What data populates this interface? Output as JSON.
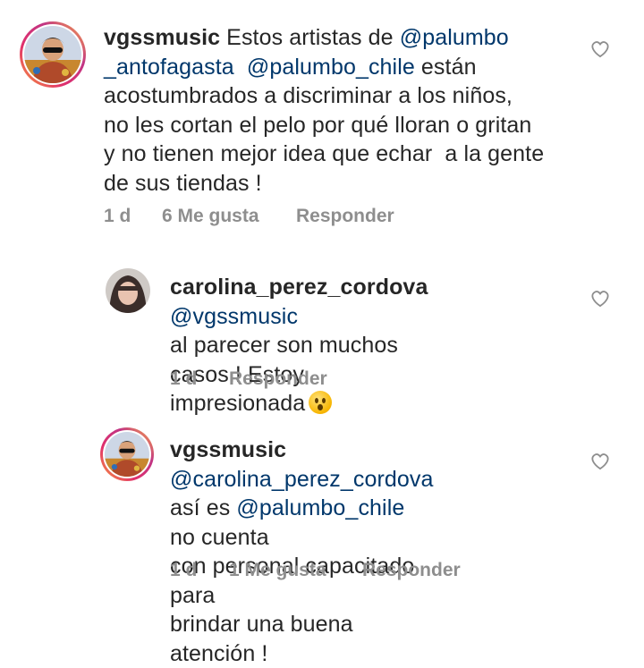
{
  "comments": [
    {
      "username": "vgssmusic",
      "text_parts": [
        {
          "t": "Estos artistas de "
        },
        {
          "t": "@palumbo _antofagasta",
          "mention": true
        },
        {
          "t": " "
        },
        {
          "t": "@palumbo_chile",
          "mention": true
        },
        {
          "t": " están acostumbrados a discriminar a los niños, no les cortan el pelo por qué lloran o gritan y no tienen mejor idea que echar  a la gente de sus tiendas !"
        }
      ],
      "lines": [
        "vgssmusic Estos artistas de @palumbo",
        "_antofagasta  @palumbo_chile están",
        "acostumbrados a discriminar a los niños,",
        "no les cortan el pelo por qué lloran o gritan",
        "y no tienen mejor idea que echar  a la gente",
        "de sus tiendas !"
      ],
      "time": "1 d",
      "likes": "6 Me gusta",
      "reply": "Responder"
    },
    {
      "username": "carolina_perez_cordova",
      "time": "1 d",
      "likes": "",
      "reply": "Responder"
    },
    {
      "username": "vgssmusic",
      "time": "1 d",
      "likes": "1 Me gusta",
      "reply": "Responder"
    }
  ],
  "c1": {
    "l1_user": "vgssmusic",
    "l1_a": " Estos artistas de ",
    "l1_m": "@palumbo",
    "l2_m1": "_antofagasta",
    "l2_gap": "  ",
    "l2_m2": "@palumbo_chile",
    "l2_b": " están",
    "l3": "acostumbrados a discriminar a los niños,",
    "l4": "no les cortan el pelo por qué lloran o gritan",
    "l5": "y no tienen mejor idea que echar  a la gente",
    "l6": "de sus tiendas !"
  },
  "c2": {
    "l1_user": "carolina_perez_cordova",
    "l1_m": "@vgssmusic",
    "l2": "al parecer son muchos casos.! Estoy",
    "l3": "impresionada",
    "emoji": "hushed-face-emoji"
  },
  "c3": {
    "l1_user": "vgssmusic",
    "l1_m": "@carolina_perez_cordova",
    "l2_a": "así es ",
    "l2_m": "@palumbo_chile",
    "l2_b": " no cuenta",
    "l3": "con personal capacitado para",
    "l4": "brindar una buena atención !"
  },
  "colors": {
    "text": "#262626",
    "mention": "#00376b",
    "meta": "#8e8e8e"
  },
  "icons": [
    "heart-outline-icon"
  ]
}
